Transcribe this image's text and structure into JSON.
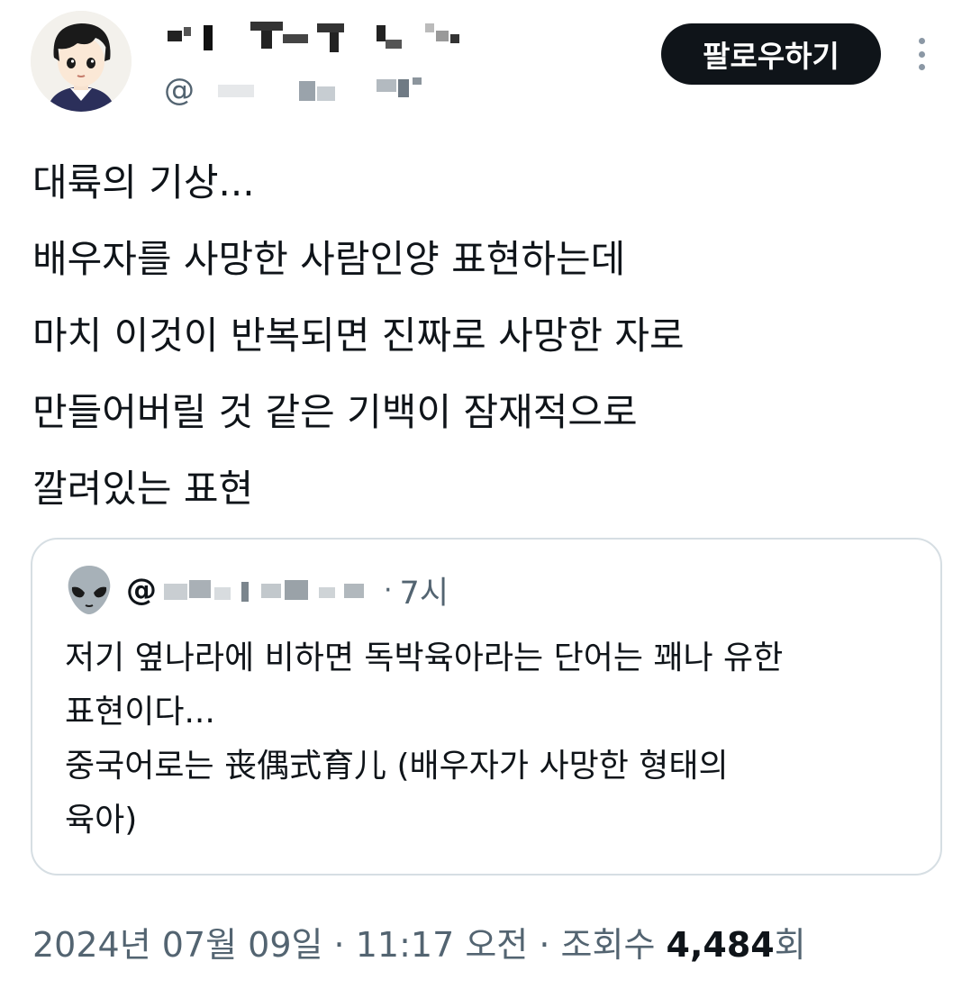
{
  "author": {
    "handle_prefix": "@"
  },
  "follow_button": {
    "label": "팔로우하기"
  },
  "tweet": {
    "lines": [
      "대륙의 기상...",
      "배우자를 사망한 사람인양 표현하는데",
      "마치 이것이 반복되면 진짜로 사망한 자로",
      "만들어버릴 것 같은 기백이 잠재적으로",
      "깔려있는 표현"
    ]
  },
  "quote": {
    "handle_prefix": "@",
    "separator": "·",
    "time": "7시",
    "lines": [
      "저기 옆나라에 비하면 독박육아라는 단어는 꽤나 유한",
      "표현이다...",
      "중국어로는 丧偶式育儿 (배우자가 사망한 형태의",
      "육아)"
    ]
  },
  "meta": {
    "date": "2024년 07월 09일",
    "separator1": "·",
    "time": "11:17 오전",
    "separator2": "·",
    "views_label": "조회수",
    "views_count": "4,484",
    "views_suffix": "회"
  },
  "colors": {
    "text_primary": "#0f1419",
    "text_secondary": "#536471",
    "button_bg": "#0f1419",
    "border": "#d6dee3"
  },
  "icons": {
    "avatar": "cartoon-boy-avatar",
    "quote_avatar": "alien-emoji-avatar",
    "more": "more-vertical-icon"
  }
}
